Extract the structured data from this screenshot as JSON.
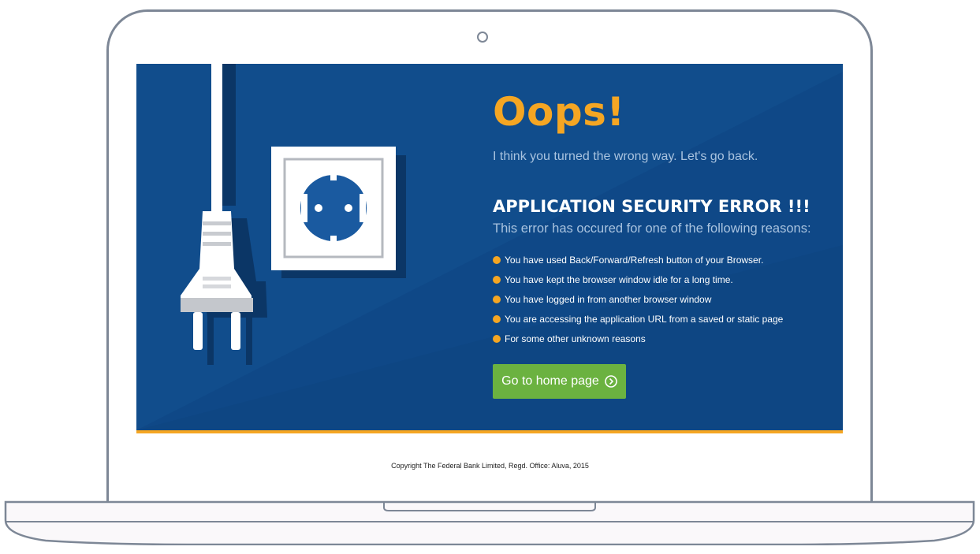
{
  "error_page": {
    "heading_oops": "Oops!",
    "subtitle": "I think you turned the wrong way. Let's go back.",
    "error_title": "APPLICATION SECURITY ERROR !!!",
    "error_subtitle": "This error has occured for one of the following reasons:",
    "reasons": [
      "You have used Back/Forward/Refresh button of your Browser.",
      "You have kept the browser window idle for a long time.",
      "You have logged in from another browser window",
      "You are accessing the application URL from a saved or static page",
      "For some other unknown reasons"
    ],
    "home_button_label": "Go to home page",
    "home_button_icon": "chevron-circle-right-icon"
  },
  "illustration": {
    "plug_icon": "power-plug-icon",
    "socket_icon": "power-socket-icon"
  },
  "footer": {
    "copyright": "Copyright The Federal Bank Limited, Regd. Office: Aluva, 2015"
  },
  "colors": {
    "background": "#114d8c",
    "accent": "#f5a623",
    "button": "#6bb240",
    "muted_text": "#a9c3df"
  }
}
